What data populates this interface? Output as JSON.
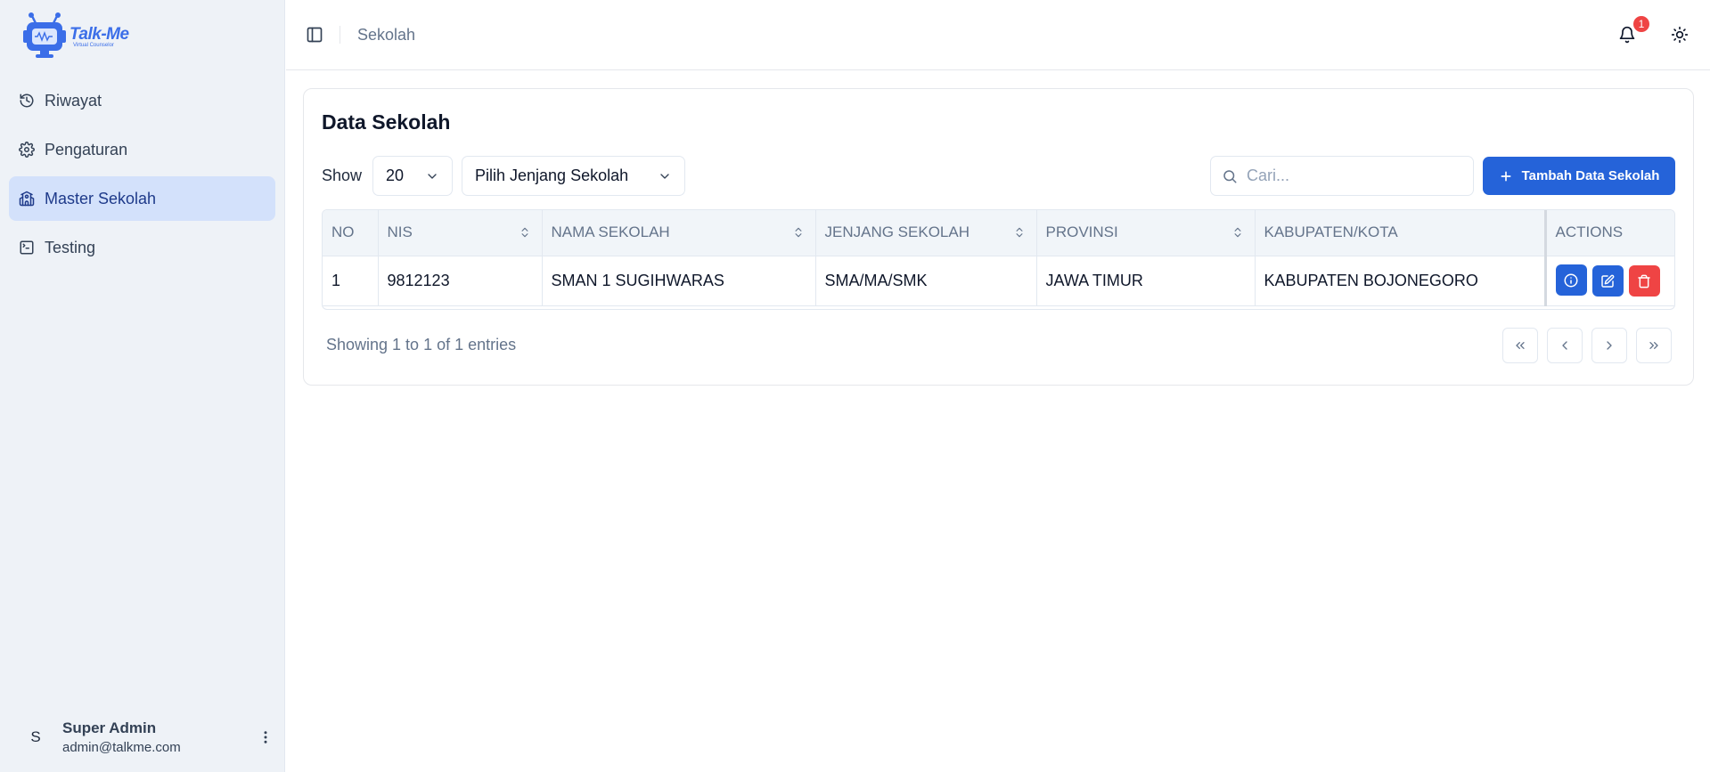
{
  "app": {
    "logo_title": "Talk-Me",
    "logo_subtitle": "Virtual Counselor"
  },
  "sidebar": {
    "items": [
      {
        "label": "Riwayat",
        "icon": "history-icon"
      },
      {
        "label": "Pengaturan",
        "icon": "gear-icon"
      },
      {
        "label": "Master Sekolah",
        "icon": "school-icon",
        "active": true
      },
      {
        "label": "Testing",
        "icon": "terminal-icon"
      }
    ],
    "user": {
      "initial": "S",
      "name": "Super Admin",
      "email": "admin@talkme.com"
    }
  },
  "header": {
    "breadcrumb": "Sekolah",
    "notification_count": "1"
  },
  "main": {
    "title": "Data Sekolah",
    "show_label": "Show",
    "page_size": "20",
    "level_select": "Pilih Jenjang Sekolah",
    "search_placeholder": "Cari...",
    "add_button": "Tambah Data Sekolah",
    "table": {
      "columns": [
        "NO",
        "NIS",
        "NAMA SEKOLAH",
        "JENJANG SEKOLAH",
        "PROVINSI",
        "KABUPATEN/KOTA",
        "ACTIONS"
      ],
      "rows": [
        [
          "1",
          "9812123",
          "SMAN 1 SUGIHWARAS",
          "SMA/MA/SMK",
          "JAWA TIMUR",
          "KABUPATEN BOJONEGORO"
        ]
      ]
    },
    "entries_text": "Showing 1 to 1 of 1 entries"
  },
  "colors": {
    "primary": "#2563d9",
    "danger": "#ef4444",
    "sidebar_bg": "#eef2f7",
    "active_item": "#d3e1fb"
  }
}
